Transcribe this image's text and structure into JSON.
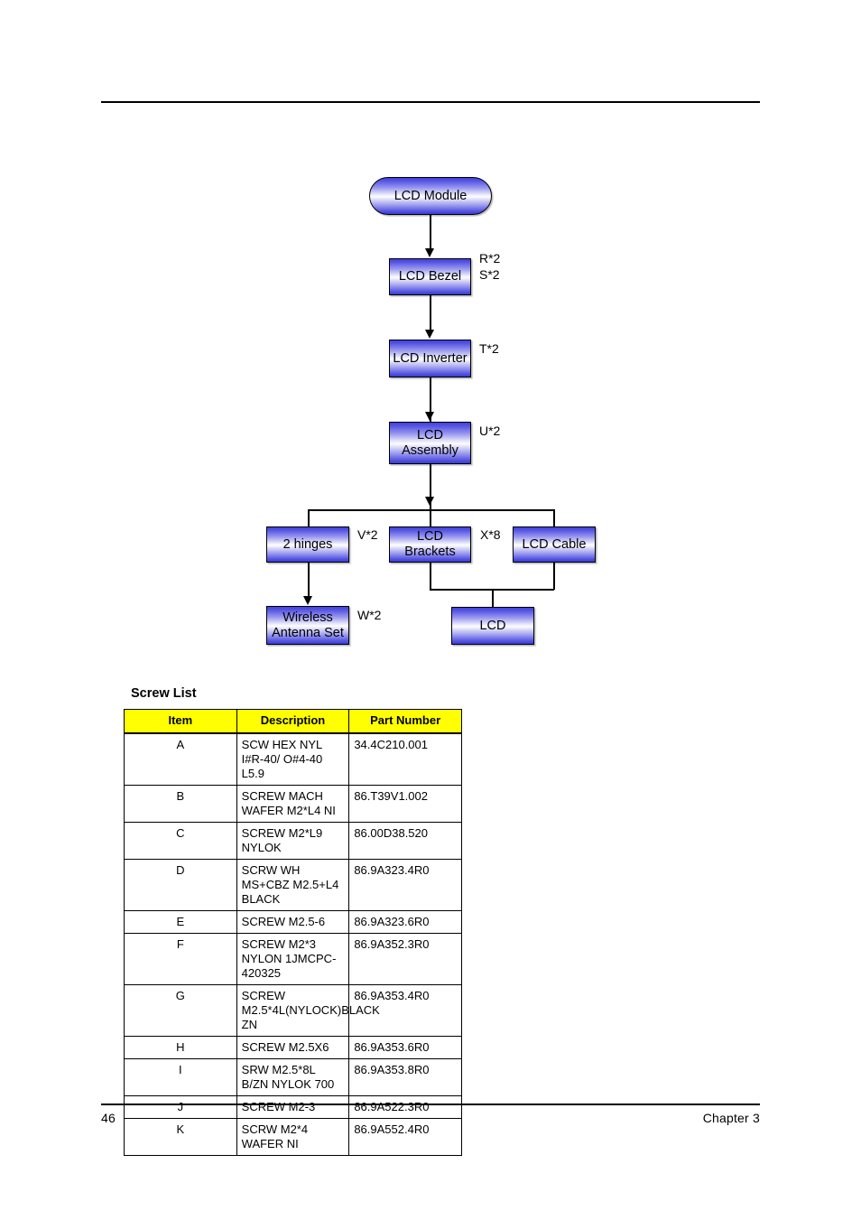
{
  "footer": {
    "page_number": "46",
    "chapter": "Chapter 3"
  },
  "flowchart": {
    "nodes": {
      "lcd_module": "LCD Module",
      "lcd_bezel": "LCD Bezel",
      "lcd_inverter": "LCD Inverter",
      "lcd_assembly": "LCD\nAssembly",
      "two_hinges": "2 hinges",
      "lcd_brackets": "LCD Brackets",
      "lcd_cable": "LCD Cable",
      "wireless_antenna_set": "Wireless\nAntenna Set",
      "lcd": "LCD"
    },
    "quantities": {
      "bezel": "R*2\nS*2",
      "inverter": "T*2",
      "assembly": "U*2",
      "hinges": "V*2",
      "brackets": "X*8",
      "antenna": "W*2"
    }
  },
  "screw_list": {
    "title": "Screw List",
    "columns": [
      "Item",
      "Description",
      "Part Number"
    ],
    "rows": [
      {
        "item": "A",
        "description": "SCW HEX NYL I#R-40/ O#4-40 L5.9",
        "part_number": "34.4C210.001"
      },
      {
        "item": "B",
        "description": "SCREW MACH WAFER M2*L4 NI",
        "part_number": "86.T39V1.002"
      },
      {
        "item": "C",
        "description": "SCREW M2*L9 NYLOK",
        "part_number": "86.00D38.520"
      },
      {
        "item": "D",
        "description": "SCRW WH MS+CBZ M2.5+L4 BLACK",
        "part_number": "86.9A323.4R0"
      },
      {
        "item": "E",
        "description": "SCREW M2.5-6",
        "part_number": "86.9A323.6R0"
      },
      {
        "item": "F",
        "description": "SCREW M2*3 NYLON 1JMCPC-420325",
        "part_number": "86.9A352.3R0"
      },
      {
        "item": "G",
        "description": "SCREW M2.5*4L(NYLOCK)BLACK ZN",
        "part_number": "86.9A353.4R0"
      },
      {
        "item": "H",
        "description": "SCREW M2.5X6",
        "part_number": "86.9A353.6R0"
      },
      {
        "item": "I",
        "description": "SRW M2.5*8L B/ZN NYLOK 700",
        "part_number": "86.9A353.8R0"
      },
      {
        "item": "J",
        "description": "SCREW M2-3",
        "part_number": "86.9A522.3R0"
      },
      {
        "item": "K",
        "description": "SCRW M2*4 WAFER NI",
        "part_number": "86.9A552.4R0"
      }
    ]
  }
}
